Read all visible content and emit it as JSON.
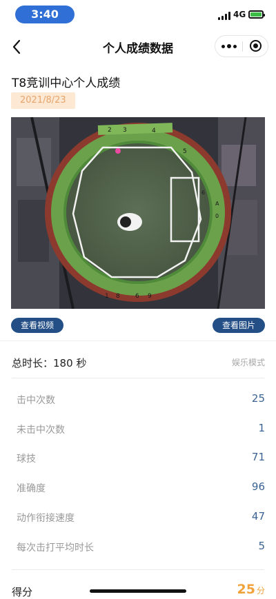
{
  "status_bar": {
    "time": "3:40",
    "network": "4G",
    "battery_color": "#3dbb47"
  },
  "nav": {
    "title": "个人成绩数据",
    "back_icon": "chevron-left-icon",
    "more_icon": "more-dots-icon",
    "close_icon": "mini-program-close-icon"
  },
  "record": {
    "title": "T8竞训中心个人成绩",
    "date": "2021/8/23"
  },
  "photo": {
    "wall_panel_labels": [
      "2",
      "3",
      "4",
      "5",
      "6",
      "A",
      "0",
      "1",
      "8",
      "6",
      "9"
    ]
  },
  "buttons": {
    "view_video": "查看视频",
    "view_image": "查看图片"
  },
  "summary": {
    "total_label": "总时长：",
    "total_value": "180",
    "total_unit": "秒",
    "mode": "娱乐模式"
  },
  "stats": [
    {
      "label": "击中次数",
      "value": "25"
    },
    {
      "label": "未击中次数",
      "value": "1"
    },
    {
      "label": "球技",
      "value": "71"
    },
    {
      "label": "准确度",
      "value": "96"
    },
    {
      "label": "动作衔接速度",
      "value": "47"
    },
    {
      "label": "每次击打平均时长",
      "value": "5"
    }
  ],
  "score": {
    "label": "得分",
    "value": "25",
    "unit": "分"
  },
  "colors": {
    "accent": "#234f86",
    "value_text": "#3a6292",
    "score": "#f2a23a",
    "date_bg": "#fde8d4",
    "date_text": "#e8a46a"
  }
}
